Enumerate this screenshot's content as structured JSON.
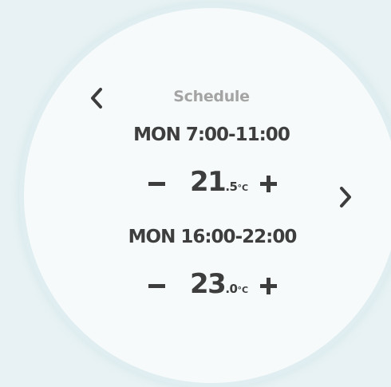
{
  "screen": {
    "title": "Schedule"
  },
  "navigation": {
    "prev_icon": "chevron-left-icon",
    "next_icon": "chevron-right-icon"
  },
  "periods": [
    {
      "label": "MON 7:00-11:00",
      "temperature_integer": "21",
      "temperature_decimal": ".5",
      "unit": "°C",
      "decrease_icon": "minus-icon",
      "increase_icon": "plus-icon"
    },
    {
      "label": "MON 16:00-22:00",
      "temperature_integer": "23",
      "temperature_decimal": ".0",
      "unit": "°C",
      "decrease_icon": "minus-icon",
      "increase_icon": "plus-icon"
    }
  ],
  "colors": {
    "background": "#e8f2f4",
    "dial": "#f6fafa",
    "text_primary": "#3d3d3d",
    "text_secondary": "#a4a4a4"
  }
}
